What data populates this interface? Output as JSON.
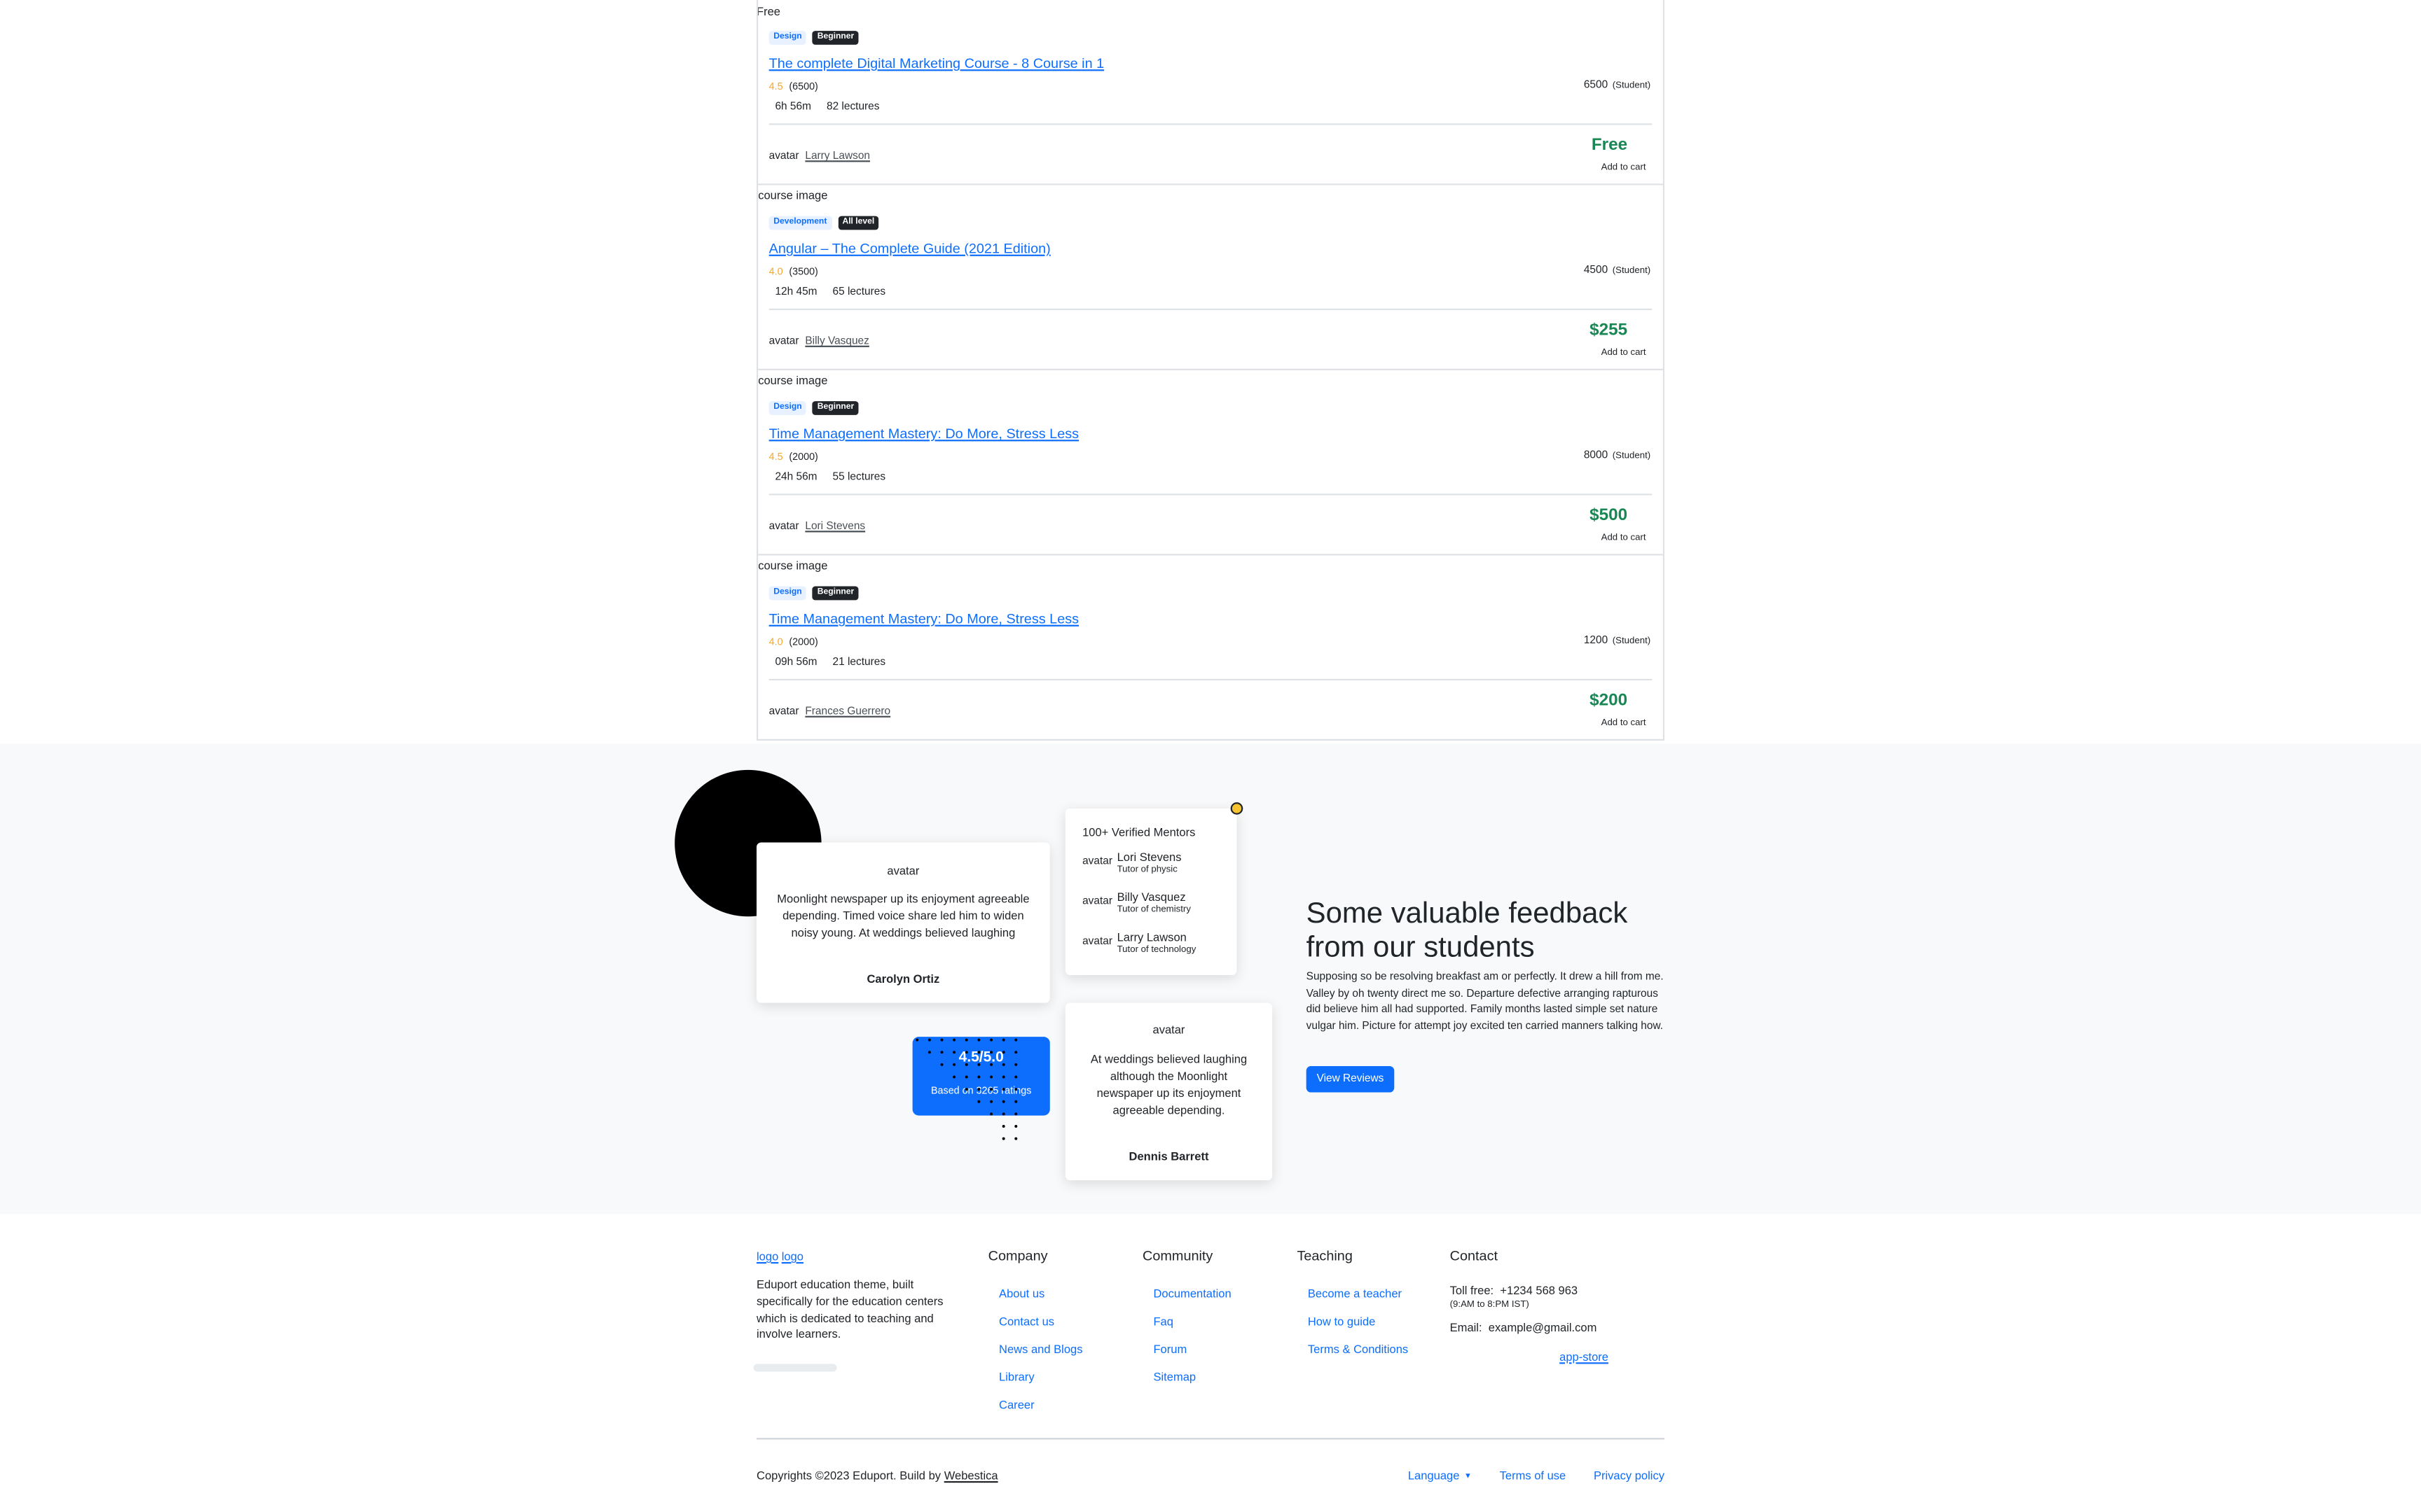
{
  "courses": {
    "top_price_label": "Free",
    "items": [
      {
        "image_alt": "",
        "category": "Design",
        "level": "Beginner",
        "title": "The complete Digital Marketing Course - 8 Course in 1",
        "rating": "4.5",
        "rating_count": "(6500)",
        "students": "6500",
        "students_label": "(Student)",
        "duration": "6h 56m",
        "lectures": "82 lectures",
        "avatar_alt": "avatar",
        "instructor": "Larry Lawson",
        "price": "Free",
        "add_to_cart": "Add to cart"
      },
      {
        "image_alt": "course image",
        "category": "Development",
        "level": "All level",
        "title": "Angular – The Complete Guide (2021 Edition)",
        "rating": "4.0",
        "rating_count": "(3500)",
        "students": "4500",
        "students_label": "(Student)",
        "duration": "12h 45m",
        "lectures": "65 lectures",
        "avatar_alt": "avatar",
        "instructor": "Billy Vasquez",
        "price": "$255",
        "add_to_cart": "Add to cart"
      },
      {
        "image_alt": "course image",
        "category": "Design",
        "level": "Beginner",
        "title": "Time Management Mastery: Do More, Stress Less",
        "rating": "4.5",
        "rating_count": "(2000)",
        "students": "8000",
        "students_label": "(Student)",
        "duration": "24h 56m",
        "lectures": "55 lectures",
        "avatar_alt": "avatar",
        "instructor": "Lori Stevens",
        "price": "$500",
        "add_to_cart": "Add to cart"
      },
      {
        "image_alt": "course image",
        "category": "Design",
        "level": "Beginner",
        "title": "Time Management Mastery: Do More, Stress Less",
        "rating": "4.0",
        "rating_count": "(2000)",
        "students": "1200",
        "students_label": "(Student)",
        "duration": "09h 56m",
        "lectures": "21 lectures",
        "avatar_alt": "avatar",
        "instructor": "Frances Guerrero",
        "price": "$200",
        "add_to_cart": "Add to cart"
      }
    ]
  },
  "feedback": {
    "testimonial_1": {
      "avatar_alt": "avatar",
      "quote": "Moonlight newspaper up its enjoyment agreeable depending. Timed voice share led him to widen noisy young. At weddings believed laughing",
      "name": "Carolyn Ortiz"
    },
    "testimonial_2": {
      "avatar_alt": "avatar",
      "quote": "At weddings believed laughing although the Moonlight newspaper up its enjoyment agreeable depending.",
      "name": "Dennis Barrett"
    },
    "mentors": {
      "heading": "100+ Verified Mentors",
      "items": [
        {
          "avatar_alt": "avatar",
          "name": "Lori Stevens",
          "role": "Tutor of physic"
        },
        {
          "avatar_alt": "avatar",
          "name": "Billy Vasquez",
          "role": "Tutor of chemistry"
        },
        {
          "avatar_alt": "avatar",
          "name": "Larry Lawson",
          "role": "Tutor of technology"
        }
      ]
    },
    "rating_box": {
      "score": "4.5/5.0",
      "based_on": "Based on 3265 ratings"
    },
    "title": "Some valuable feedback from our students",
    "text": "Supposing so be resolving breakfast am or perfectly. It drew a hill from me. Valley by oh twenty direct me so. Departure defective arranging rapturous did believe him all had supported. Family months lasted simple set nature vulgar him. Picture for attempt joy excited ten carried manners talking how.",
    "button": "View Reviews",
    "colors": {
      "accent": "#0d6efd",
      "background": "#f8f9fa",
      "blob": "#000000",
      "shield": "#f7c32e"
    }
  },
  "footer": {
    "logo_alts": [
      "logo",
      "logo"
    ],
    "description": "Eduport education theme, built specifically for the education centers which is dedicated to teaching and involve learners.",
    "columns": [
      {
        "heading": "Company",
        "links": [
          "About us",
          "Contact us",
          "News and Blogs",
          "Library",
          "Career"
        ]
      },
      {
        "heading": "Community",
        "links": [
          "Documentation",
          "Faq",
          "Forum",
          "Sitemap"
        ]
      },
      {
        "heading": "Teaching",
        "links": [
          "Become a teacher",
          "How to guide",
          "Terms & Conditions"
        ]
      }
    ],
    "contact": {
      "heading": "Contact",
      "toll_free_label": "Toll free:",
      "toll_free": "+1234 568 963",
      "hours": "(9:AM to 8:PM IST)",
      "email_label": "Email:",
      "email": "example@gmail.com",
      "app_store_alt": "app-store"
    },
    "copyright_prefix": "Copyrights ©2023 Eduport. Build by",
    "copyright_link": "Webestica",
    "language": "Language",
    "terms": "Terms of use",
    "privacy": "Privacy policy"
  }
}
